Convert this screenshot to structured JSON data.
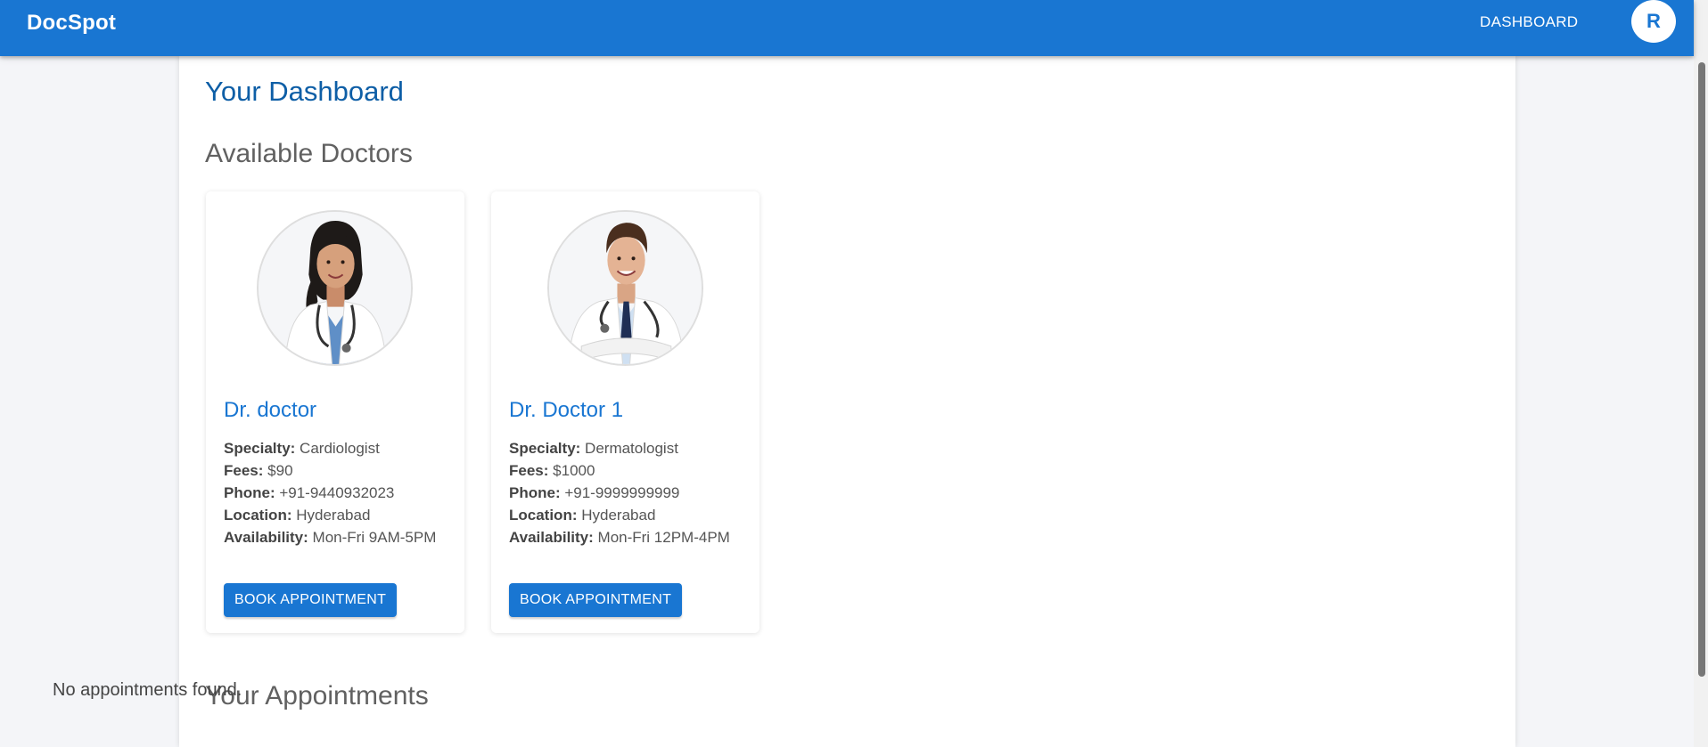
{
  "app": {
    "brand": "DocSpot",
    "nav_dashboard": "DASHBOARD",
    "avatar_initial": "R"
  },
  "page": {
    "title": "Your Dashboard",
    "doctors_section_title": "Available Doctors",
    "appointments_section_title": "Your Appointments",
    "appointments_empty": "No appointments found."
  },
  "doctors": [
    {
      "name": "Dr. doctor",
      "specialty_label": "Specialty:",
      "specialty": "Cardiologist",
      "fees_label": "Fees:",
      "fees": "$90",
      "phone_label": "Phone:",
      "phone": "+91-9440932023",
      "location_label": "Location:",
      "location": "Hyderabad",
      "availability_label": "Availability:",
      "availability": "Mon-Fri 9AM-5PM",
      "button_label": "BOOK APPOINTMENT",
      "photo_icon": "female-doctor-photo"
    },
    {
      "name": "Dr. Doctor 1",
      "specialty_label": "Specialty:",
      "specialty": "Dermatologist",
      "fees_label": "Fees:",
      "fees": "$1000",
      "phone_label": "Phone:",
      "phone": "+91-9999999999",
      "location_label": "Location:",
      "location": "Hyderabad",
      "availability_label": "Availability:",
      "availability": "Mon-Fri 12PM-4PM",
      "button_label": "BOOK APPOINTMENT",
      "photo_icon": "male-doctor-photo"
    }
  ],
  "colors": {
    "primary": "#1976d2",
    "title_blue": "#0d5ea6",
    "section_gray": "#616161",
    "page_bg": "#f4f5f8"
  }
}
